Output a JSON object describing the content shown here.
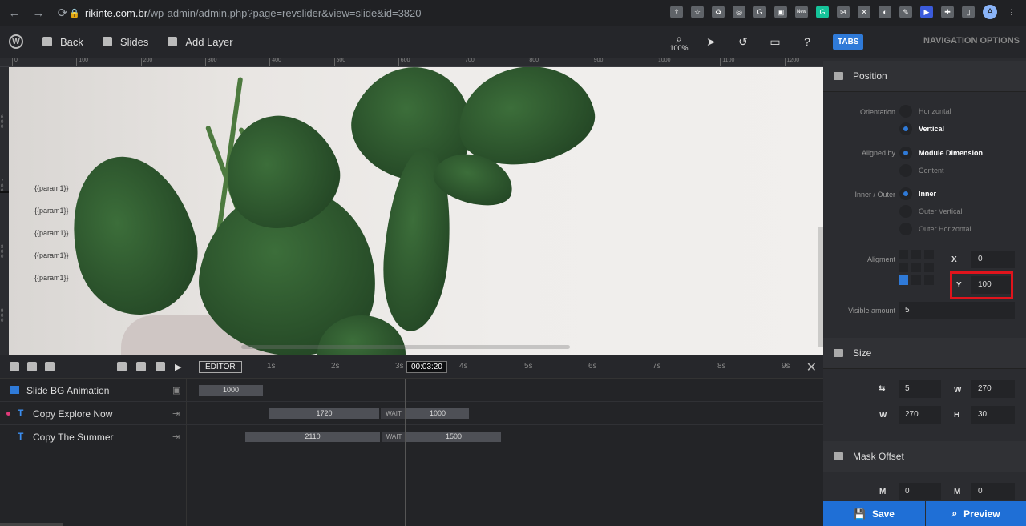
{
  "browser": {
    "host": "rikinte.com.br",
    "path": "/wp-admin/admin.php?page=revslider&view=slide&id=3820",
    "avatar_letter": "A",
    "ext_badge_new": "New",
    "ext_badge_count": "54"
  },
  "toolbar": {
    "back_label": "Back",
    "slides_label": "Slides",
    "add_layer_label": "Add Layer",
    "zoom": "100%"
  },
  "ruler": {
    "marks": [
      "0",
      "100",
      "200",
      "300",
      "400",
      "500",
      "600",
      "700",
      "800",
      "900",
      "1000",
      "1100",
      "1200"
    ]
  },
  "canvas": {
    "params": [
      "{{param1}}",
      "{{param1}}",
      "{{param1}}",
      "{{param1}}",
      "{{param1}}"
    ]
  },
  "timeline": {
    "editor_label": "EDITOR",
    "seconds": [
      "1s",
      "2s",
      "3s",
      "4s",
      "5s",
      "6s",
      "7s",
      "8s",
      "9s"
    ],
    "current_time": "00:03:20",
    "rows": [
      {
        "label": "Slide BG Animation",
        "bar1": "1000"
      },
      {
        "label": "Copy Explore Now",
        "bar1": "1720",
        "wait": "WAIT",
        "bar2": "1000"
      },
      {
        "label": "Copy The Summer",
        "bar1": "2110",
        "wait": "WAIT",
        "bar2": "1500"
      }
    ]
  },
  "panel": {
    "tabs_label": "TABS",
    "nav_options": "NAVIGATION OPTIONS",
    "position_title": "Position",
    "orientation_label": "Orientation",
    "orientation_opts": [
      "Horizontal",
      "Vertical"
    ],
    "aligned_by_label": "Aligned by",
    "aligned_by_opts": [
      "Module Dimension",
      "Content"
    ],
    "inner_outer_label": "Inner / Outer",
    "inner_outer_opts": [
      "Inner",
      "Outer Vertical",
      "Outer Horizontal"
    ],
    "alignment_label": "Aligment",
    "x_label": "X",
    "x_value": "0",
    "y_label": "Y",
    "y_value": "100",
    "visible_amount_label": "Visible amount",
    "visible_amount_value": "5",
    "size_title": "Size",
    "size_space_value": "5",
    "size_w_label": "W",
    "size_w_value": "270",
    "size_w2_label": "W",
    "size_w2_value": "270",
    "size_h_label": "H",
    "size_h_value": "30",
    "mask_title": "Mask Offset",
    "mask_m1_label": "M",
    "mask_m1_value": "0",
    "mask_m2_label": "M",
    "mask_m2_value": "0",
    "save_label": "Save",
    "preview_label": "Preview"
  },
  "colors": {
    "accent": "#1f6fd6",
    "highlight": "#e0141c"
  }
}
